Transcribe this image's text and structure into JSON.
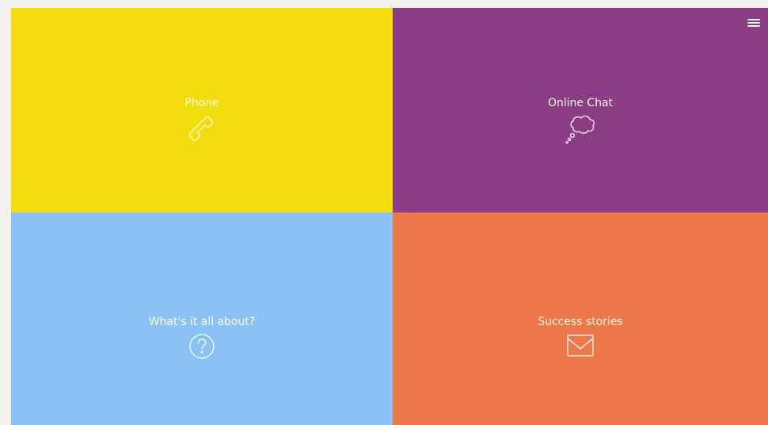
{
  "tiles": {
    "phone": {
      "label": "Phone",
      "color": "#f2dd0c",
      "icon": "phone-icon"
    },
    "chat": {
      "label": "Online Chat",
      "color": "#8a3c85",
      "icon": "thought-bubble-icon"
    },
    "about": {
      "label": "What's it all about?",
      "color": "#89c2f6",
      "icon": "question-circle-icon"
    },
    "stories": {
      "label": "Success stories",
      "color": "#ef784b",
      "icon": "envelope-check-icon"
    }
  },
  "menu": {
    "icon": "hamburger-menu-icon"
  }
}
